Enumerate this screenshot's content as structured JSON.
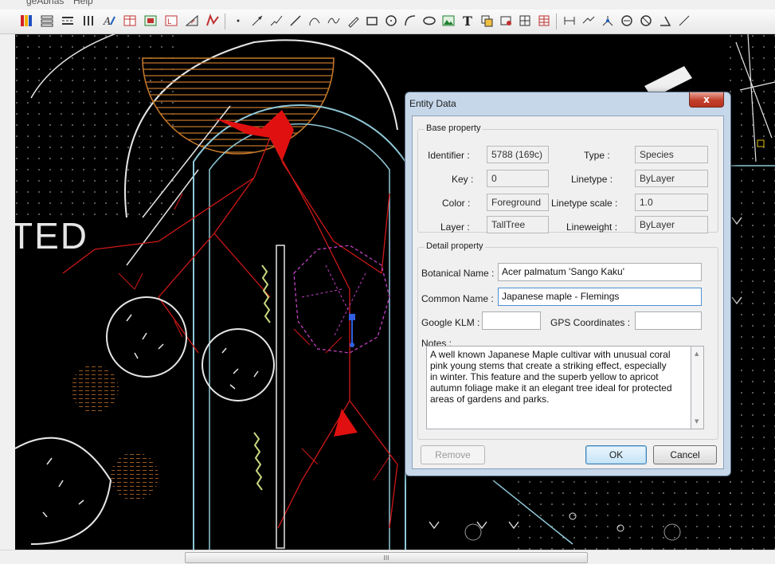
{
  "menu": {
    "items": [
      "geAbrias",
      "Help"
    ]
  },
  "toolbar": {
    "icons": [
      "layers-icon",
      "layer-list-icon",
      "linetype-icon",
      "columns-icon",
      "text-style-icon",
      "table-style-icon",
      "block-style-icon",
      "dim-style-icon",
      "measure-icon",
      "multiline-icon",
      "point-icon",
      "arrow-icon",
      "polyline-icon",
      "line-icon",
      "arc-icon",
      "spline-icon",
      "pencil-icon",
      "rectangle-icon",
      "circle-icon",
      "curve-icon",
      "ellipse-icon",
      "image-icon",
      "text-tool-icon",
      "insert-block-icon",
      "block-icon",
      "hatch-icon",
      "table-icon",
      "dimension-icon",
      "leader-icon",
      "node-icon",
      "circle-select-icon",
      "circle-cross-icon",
      "angle-icon",
      "more-icon"
    ]
  },
  "canvas": {
    "label": "TED"
  },
  "dialog": {
    "title": "Entity Data",
    "close": "x",
    "base": {
      "legend": "Base property",
      "identifier_label": "Identifier :",
      "identifier": "5788 (169c)",
      "type_label": "Type :",
      "type": "Species",
      "key_label": "Key :",
      "key": "0",
      "linetype_label": "Linetype :",
      "linetype": "ByLayer",
      "color_label": "Color :",
      "color": "Foreground",
      "linetype_scale_label": "Linetype scale :",
      "linetype_scale": "1.0",
      "layer_label": "Layer :",
      "layer": "TallTree",
      "lineweight_label": "Lineweight :",
      "lineweight": "ByLayer"
    },
    "detail": {
      "legend": "Detail property",
      "botanical_label": "Botanical Name :",
      "botanical": "Acer palmatum 'Sango Kaku'",
      "common_label": "Common Name :",
      "common": "Japanese maple - Flemings",
      "klm_label": "Google KLM :",
      "klm": "",
      "gps_label": "GPS Coordinates :",
      "gps": "",
      "notes_label": "Notes :",
      "notes": "A well known Japanese Maple cultivar with unusual coral pink young stems that create a striking effect, especially in winter. This feature and the superb yellow to apricot autumn foliage make it an elegant tree ideal for protected areas of gardens and parks."
    },
    "buttons": {
      "remove": "Remove",
      "ok": "OK",
      "cancel": "Cancel"
    }
  },
  "scrollbar": {
    "thumb_grip": "III"
  }
}
